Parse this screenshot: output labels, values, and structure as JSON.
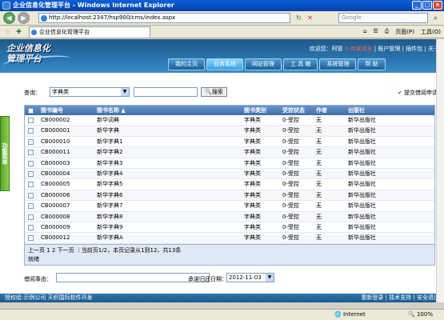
{
  "window": {
    "title": "企业信息化管理平台 - Windows Internet Explorer",
    "minimize": "_",
    "maximize": "□",
    "close": "×"
  },
  "browser": {
    "back": "◀",
    "forward": "▶",
    "url": "http://localhost:2347/hsp900/cms/index.aspx",
    "refresh": "↻",
    "stop": "✕",
    "search_placeholder": "Google",
    "tab_title": "企业信息化管理平台",
    "tools": [
      "页面(P)",
      "工具(O)"
    ]
  },
  "app": {
    "brand": [
      "企业信息化",
      "管理平台"
    ],
    "welcome_prefix": "欢迎您：阿管",
    "welcome_msg": "1 待读消息",
    "welcome_links": [
      "账户管理",
      "插件包",
      "关于"
    ],
    "nav": [
      {
        "label": "我的主页",
        "active": false
      },
      {
        "label": "业务系统",
        "active": true
      },
      {
        "label": "网站管理",
        "active": false
      },
      {
        "label": "工 具 箱",
        "active": false
      },
      {
        "label": "系统管理",
        "active": false
      },
      {
        "label": "帮  助",
        "active": false
      }
    ],
    "side_tab": "功能菜单",
    "query": {
      "label": "查询：",
      "category": "字典类",
      "search_btn": "搜索"
    },
    "submit_label": "提交借阅申请",
    "grid": {
      "headers": [
        "图书编号",
        "图书名称 ▲",
        "图书类别",
        "受控状态",
        "作者",
        "出版社"
      ],
      "rows": [
        [
          "CB000002",
          "新华词典",
          "字典类",
          "0-受控",
          "无",
          "新华出版社"
        ],
        [
          "CB000001",
          "新华字典",
          "字典类",
          "0-受控",
          "无",
          "新华出版社"
        ],
        [
          "CB000010",
          "新华字典1",
          "字典类",
          "0-受控",
          "无",
          "新华出版社"
        ],
        [
          "CB000011",
          "新华字典2",
          "字典类",
          "0-受控",
          "无",
          "新华出版社"
        ],
        [
          "CB000003",
          "新华字典3",
          "字典类",
          "0-受控",
          "无",
          "新华出版社"
        ],
        [
          "CB000004",
          "新华字典4",
          "字典类",
          "0-受控",
          "无",
          "新华出版社"
        ],
        [
          "CB000005",
          "新华字典5",
          "字典类",
          "0-受控",
          "无",
          "新华出版社"
        ],
        [
          "CB000006",
          "新华字典6",
          "字典类",
          "0-受控",
          "无",
          "新华出版社"
        ],
        [
          "CB000007",
          "新华字典7",
          "字典类",
          "0-受控",
          "无",
          "新华出版社"
        ],
        [
          "CB000008",
          "新华字典8",
          "字典类",
          "0-受控",
          "无",
          "新华出版社"
        ],
        [
          "CB000009",
          "新华字典9",
          "字典类",
          "0-受控",
          "无",
          "新华出版社"
        ],
        [
          "CB000012",
          "新华字典A",
          "字典类",
          "0-受控",
          "无",
          "新华出版社"
        ]
      ],
      "pager": "上一页 1 2 下一页 ｜当前页1/2，本页记录从1到12，共13条",
      "pager_line2": "就绪"
    },
    "form": {
      "reason_label": "借阅事由：",
      "date_label": "承诺归还日期：",
      "date_value": "2012-11-03"
    },
    "footer_left": "授权给:示例公司  天织国际软件开发",
    "footer_right": "重新登录 | 技术支持 | 安全退出"
  },
  "status": {
    "zone": "Internet",
    "zoom": "100%"
  }
}
